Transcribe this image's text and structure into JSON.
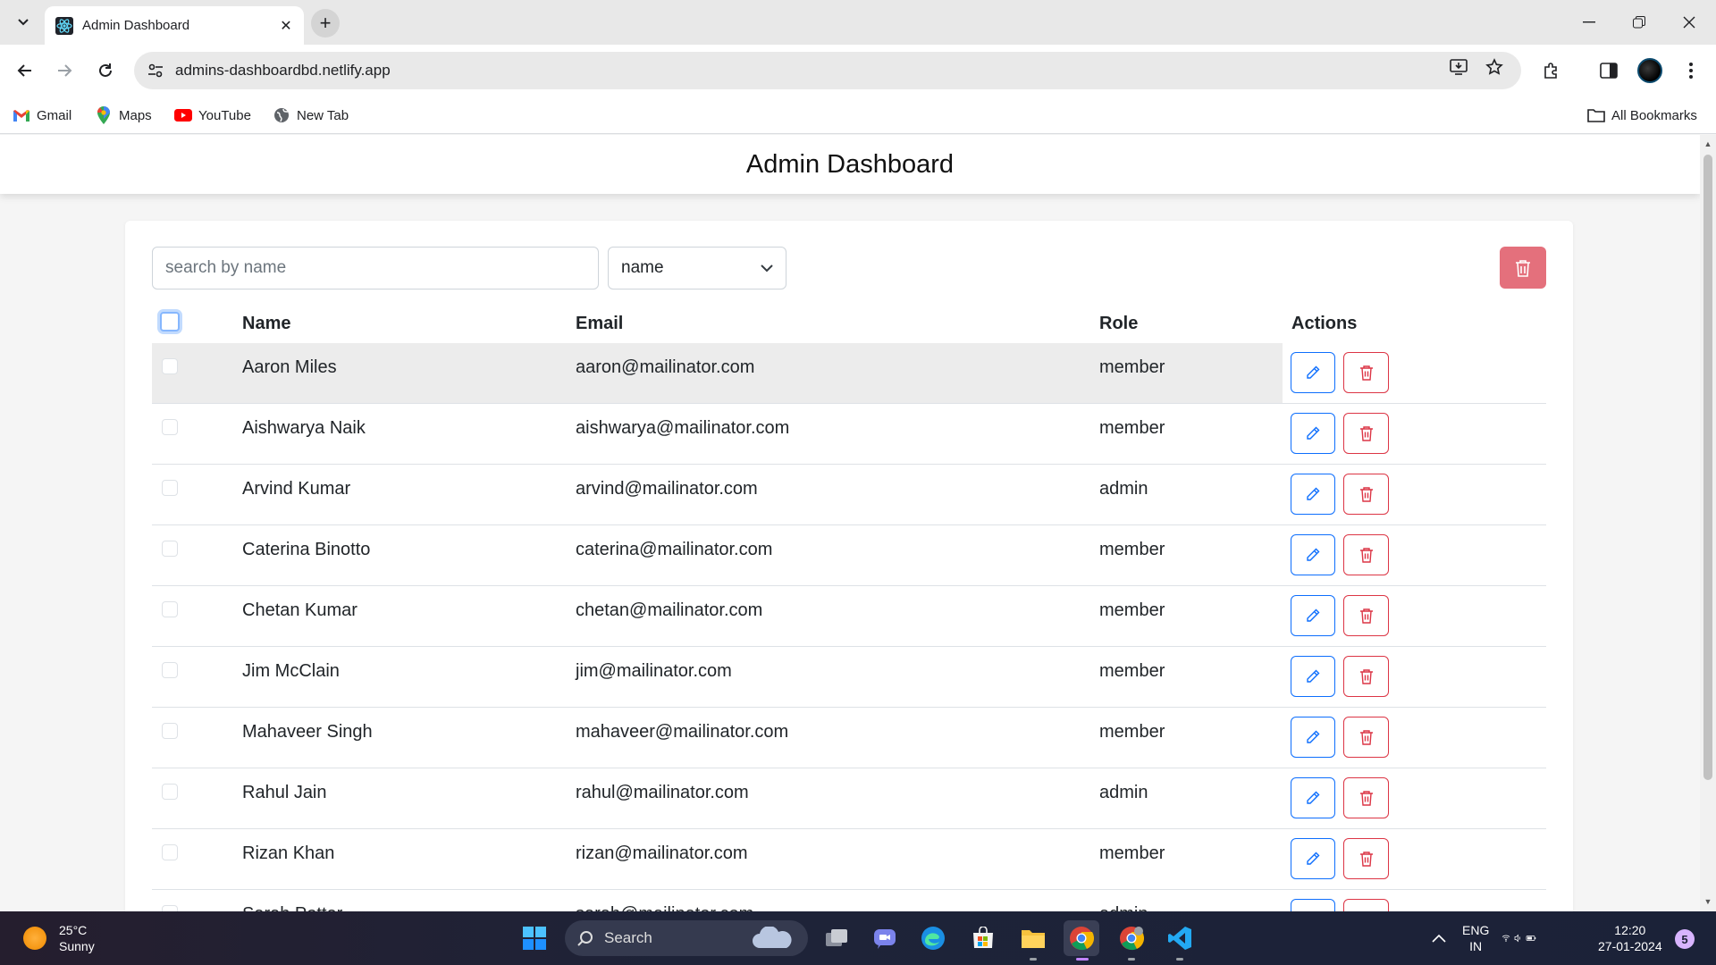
{
  "browser": {
    "tab_title": "Admin Dashboard",
    "url": "admins-dashboardbd.netlify.app",
    "bookmarks": [
      {
        "label": "Gmail",
        "icon": "gmail-icon"
      },
      {
        "label": "Maps",
        "icon": "maps-icon"
      },
      {
        "label": "YouTube",
        "icon": "youtube-icon"
      },
      {
        "label": "New Tab",
        "icon": "globe-icon"
      }
    ],
    "all_bookmarks_label": "All Bookmarks"
  },
  "page": {
    "title": "Admin Dashboard",
    "search_placeholder": "search by name",
    "filter_value": "name",
    "columns": {
      "name": "Name",
      "email": "Email",
      "role": "Role",
      "actions": "Actions"
    },
    "users": [
      {
        "name": "Aaron Miles",
        "email": "aaron@mailinator.com",
        "role": "member"
      },
      {
        "name": "Aishwarya Naik",
        "email": "aishwarya@mailinator.com",
        "role": "member"
      },
      {
        "name": "Arvind Kumar",
        "email": "arvind@mailinator.com",
        "role": "admin"
      },
      {
        "name": "Caterina Binotto",
        "email": "caterina@mailinator.com",
        "role": "member"
      },
      {
        "name": "Chetan Kumar",
        "email": "chetan@mailinator.com",
        "role": "member"
      },
      {
        "name": "Jim McClain",
        "email": "jim@mailinator.com",
        "role": "member"
      },
      {
        "name": "Mahaveer Singh",
        "email": "mahaveer@mailinator.com",
        "role": "member"
      },
      {
        "name": "Rahul Jain",
        "email": "rahul@mailinator.com",
        "role": "admin"
      },
      {
        "name": "Rizan Khan",
        "email": "rizan@mailinator.com",
        "role": "member"
      },
      {
        "name": "Sarah Potter",
        "email": "sarah@mailinator.com",
        "role": "admin"
      }
    ]
  },
  "taskbar": {
    "temperature": "25°C",
    "weather": "Sunny",
    "search_label": "Search",
    "lang_line1": "ENG",
    "lang_line2": "IN",
    "time": "12:20",
    "date": "27-01-2024",
    "notification_count": "5"
  },
  "colors": {
    "edit_outline": "#0d6efd",
    "delete_outline": "#dc3545",
    "bulk_delete_bg": "#e4707c"
  }
}
